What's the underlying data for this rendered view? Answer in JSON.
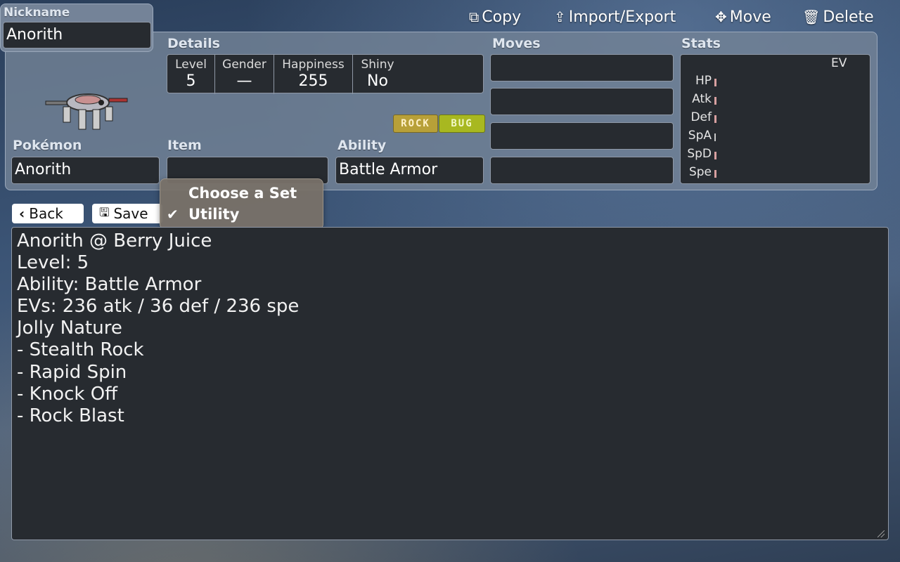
{
  "toolbar": {
    "copy_label": "Copy",
    "import_export_label": "Import/Export",
    "move_label": "Move",
    "delete_label": "Delete"
  },
  "nickname": {
    "label": "Nickname",
    "value": "Anorith"
  },
  "details": {
    "label": "Details",
    "level": {
      "label": "Level",
      "value": "5"
    },
    "gender": {
      "label": "Gender",
      "value": "—"
    },
    "happiness": {
      "label": "Happiness",
      "value": "255"
    },
    "shiny": {
      "label": "Shiny",
      "value": "No"
    }
  },
  "types": [
    {
      "name": "ROCK",
      "color": "#b8a038"
    },
    {
      "name": "BUG",
      "color": "#a8b820"
    }
  ],
  "pokemon": {
    "label": "Pokémon",
    "value": "Anorith"
  },
  "item": {
    "label": "Item",
    "value": ""
  },
  "ability": {
    "label": "Ability",
    "value": "Battle Armor"
  },
  "moves": {
    "label": "Moves",
    "slots": [
      "",
      "",
      "",
      ""
    ]
  },
  "stats": {
    "label": "Stats",
    "ev_header": "EV",
    "rows": [
      "HP",
      "Atk",
      "Def",
      "SpA",
      "SpD",
      "Spe"
    ]
  },
  "actions": {
    "back_label": "Back",
    "save_label": "Save"
  },
  "set_menu": {
    "title": "Choose a Set",
    "selected": "Utility"
  },
  "export_text": "Anorith @ Berry Juice\nLevel: 5\nAbility: Battle Armor\nEVs: 236 atk / 36 def / 236 spe\nJolly Nature\n- Stealth Rock\n- Rapid Spin\n- Knock Off\n- Rock Blast"
}
